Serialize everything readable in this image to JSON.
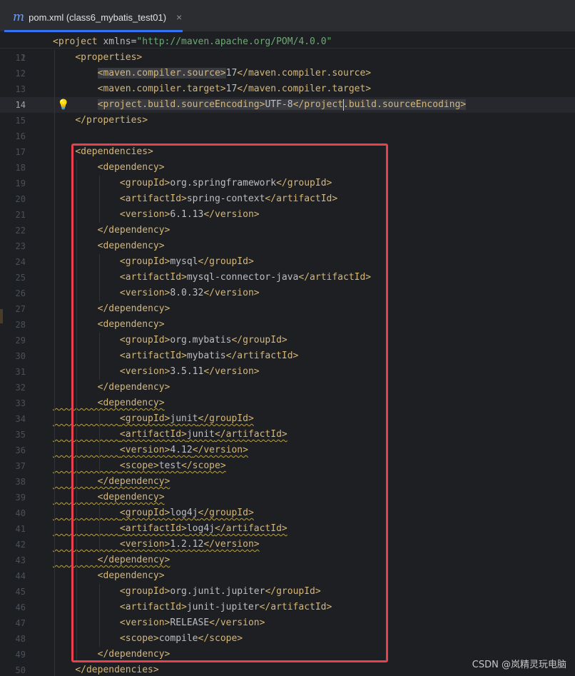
{
  "tab": {
    "icon": "maven-m-icon",
    "icon_glyph": "m",
    "title": "pom.xml (class6_mybatis_test01)",
    "close_glyph": "×"
  },
  "editor": {
    "sticky_line": {
      "number": "2",
      "open": "<project ",
      "attr": "xmlns",
      "eq": "=",
      "value": "\"http://maven.apache.org/POM/4.0.0\""
    },
    "lines": [
      {
        "n": "11",
        "t": "    <properties>"
      },
      {
        "n": "12",
        "t": "        <maven.compiler.source>17</maven.compiler.source>"
      },
      {
        "n": "13",
        "t": "        <maven.compiler.target>17</maven.compiler.target>"
      },
      {
        "n": "14",
        "t": "        <project.build.sourceEncoding>UTF-8</project.build.sourceEncoding>"
      },
      {
        "n": "15",
        "t": "    </properties>"
      },
      {
        "n": "16",
        "t": ""
      },
      {
        "n": "17",
        "t": "    <dependencies>"
      },
      {
        "n": "18",
        "t": "        <dependency>"
      },
      {
        "n": "19",
        "t": "            <groupId>org.springframework</groupId>"
      },
      {
        "n": "20",
        "t": "            <artifactId>spring-context</artifactId>"
      },
      {
        "n": "21",
        "t": "            <version>6.1.13</version>"
      },
      {
        "n": "22",
        "t": "        </dependency>"
      },
      {
        "n": "23",
        "t": "        <dependency>"
      },
      {
        "n": "24",
        "t": "            <groupId>mysql</groupId>"
      },
      {
        "n": "25",
        "t": "            <artifactId>mysql-connector-java</artifactId>"
      },
      {
        "n": "26",
        "t": "            <version>8.0.32</version>"
      },
      {
        "n": "27",
        "t": "        </dependency>"
      },
      {
        "n": "28",
        "t": "        <dependency>"
      },
      {
        "n": "29",
        "t": "            <groupId>org.mybatis</groupId>"
      },
      {
        "n": "30",
        "t": "            <artifactId>mybatis</artifactId>"
      },
      {
        "n": "31",
        "t": "            <version>3.5.11</version>"
      },
      {
        "n": "32",
        "t": "        </dependency>"
      },
      {
        "n": "33",
        "t": "        <dependency>"
      },
      {
        "n": "34",
        "t": "            <groupId>junit</groupId>"
      },
      {
        "n": "35",
        "t": "            <artifactId>junit</artifactId>"
      },
      {
        "n": "36",
        "t": "            <version>4.12</version>"
      },
      {
        "n": "37",
        "t": "            <scope>test</scope>"
      },
      {
        "n": "38",
        "t": "        </dependency>"
      },
      {
        "n": "39",
        "t": "        <dependency>"
      },
      {
        "n": "40",
        "t": "            <groupId>log4j</groupId>"
      },
      {
        "n": "41",
        "t": "            <artifactId>log4j</artifactId>"
      },
      {
        "n": "42",
        "t": "            <version>1.2.12</version>"
      },
      {
        "n": "43",
        "t": "        </dependency>"
      },
      {
        "n": "44",
        "t": "        <dependency>"
      },
      {
        "n": "45",
        "t": "            <groupId>org.junit.jupiter</groupId>"
      },
      {
        "n": "46",
        "t": "            <artifactId>junit-jupiter</artifactId>"
      },
      {
        "n": "47",
        "t": "            <version>RELEASE</version>"
      },
      {
        "n": "48",
        "t": "            <scope>compile</scope>"
      },
      {
        "n": "49",
        "t": "        </dependency>"
      },
      {
        "n": "50",
        "t": "    </dependencies>"
      }
    ],
    "current_line": "14",
    "warning_lines": [
      "33",
      "34",
      "35",
      "36",
      "37",
      "38",
      "39",
      "40",
      "41",
      "42",
      "43"
    ],
    "intention_icon": "lightbulb-icon"
  },
  "colors": {
    "tag": "#d5b778",
    "text": "#bcbec4",
    "string": "#6aab73",
    "annotation_box": "#e8404f",
    "tab_accent": "#3574f0"
  },
  "watermark": "CSDN @岚精灵玩电脑"
}
